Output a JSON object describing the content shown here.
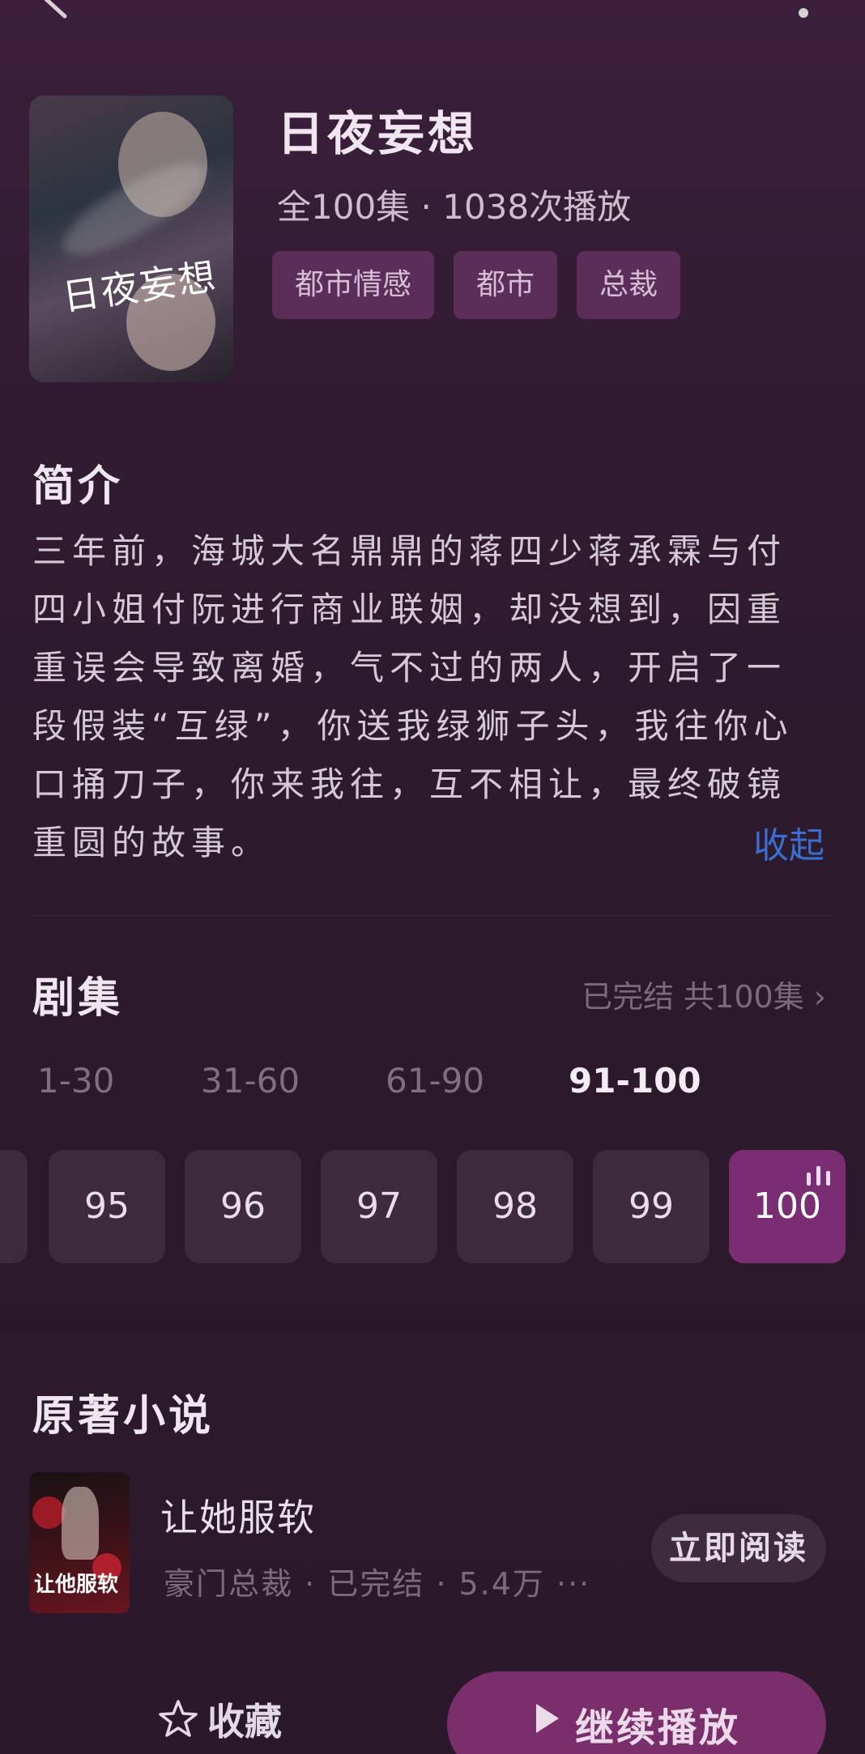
{
  "header": {
    "title": "日夜妄想",
    "meta": "全100集 · 1038次播放",
    "tags": [
      "都市情感",
      "都市",
      "总裁"
    ],
    "poster_text": "日夜妄想"
  },
  "synopsis": {
    "heading": "简介",
    "text": "三年前，海城大名鼎鼎的蒋四少蒋承霖与付四小姐付阮进行商业联姻，却没想到，因重重误会导致离婚，气不过的两人，开启了一段假装“互绿”，你送我绿狮子头，我往你心口捅刀子，你来我往，互不相让，最终破镜重圆的故事。",
    "collapse": "收起"
  },
  "episodes": {
    "heading": "剧集",
    "status": "已完结 共100集",
    "ranges": [
      "1-30",
      "31-60",
      "61-90",
      "91-100"
    ],
    "active_range": "91-100",
    "items": [
      "95",
      "96",
      "97",
      "98",
      "99",
      "100"
    ],
    "current": "100"
  },
  "novel": {
    "heading": "原著小说",
    "name": "让她服软",
    "meta": "豪门总裁 · 已完结 · 5.4万 ···",
    "read_label": "立即阅读",
    "cover_text": "让他服软"
  },
  "bottom": {
    "favorite": "收藏",
    "continue": "继续播放"
  }
}
